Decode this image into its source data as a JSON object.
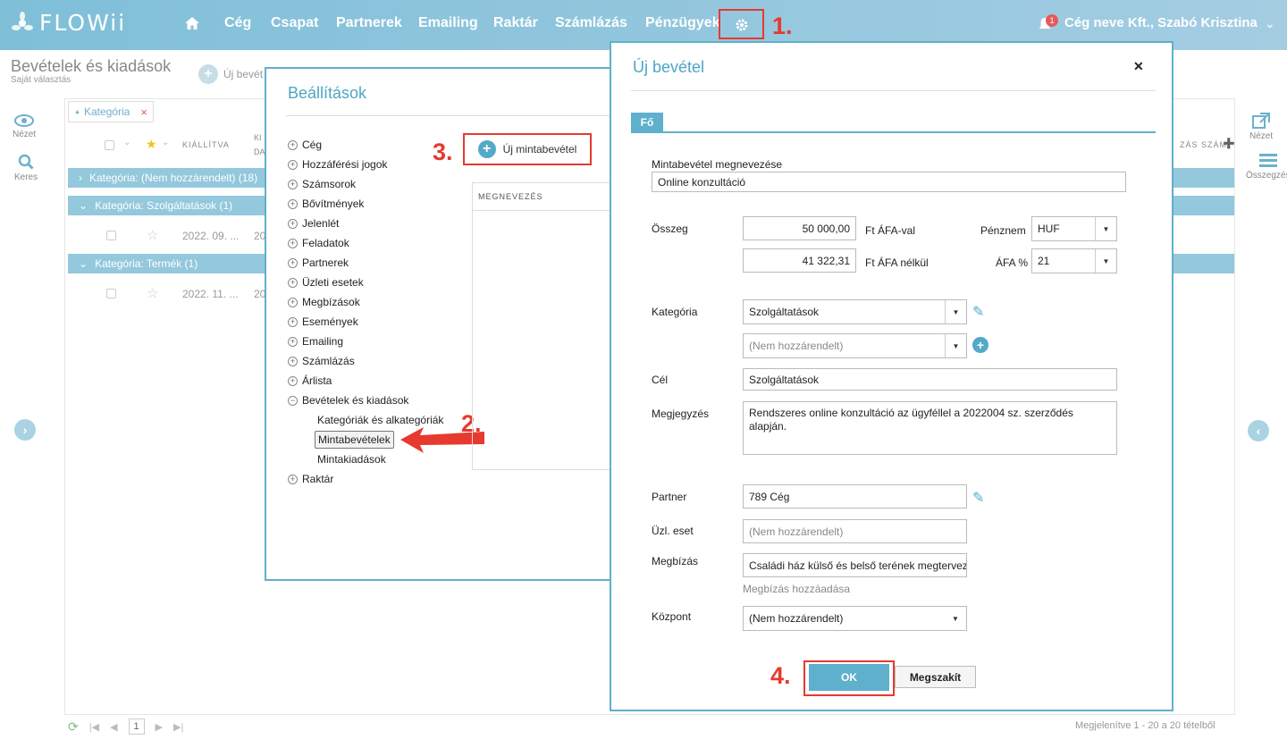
{
  "topbar": {
    "logo": "FLOWii",
    "nav": [
      "Cég",
      "Csapat",
      "Partnerek",
      "Emailing",
      "Raktár",
      "Számlázás",
      "Pénzügyek"
    ],
    "notif_count": "1",
    "user": "Cég neve Kft., Szabó Krisztina"
  },
  "steps": {
    "s1": "1.",
    "s2": "2.",
    "s3": "3.",
    "s4": "4."
  },
  "page": {
    "title": "Bevételek és kiadások",
    "subtitle": "Saját választás",
    "new_btn": "Új bevét",
    "filter_tag": "Kategória",
    "col_kiallitva": "KIÁLLÍTVA",
    "col_ki": "KI",
    "col_da": "DA",
    "col_szamla": "ZÁS SZÁM",
    "groups": [
      "Kategória: (Nem hozzárendelt) (18)",
      "Kategória: Szolgáltatások (1)",
      "Kategória: Termék (1)"
    ],
    "rows": [
      {
        "date": "2022. 09. ...",
        "col2": "20"
      },
      {
        "date": "2022. 11. ...",
        "col2": "20"
      }
    ],
    "side_left": [
      "Nézet",
      "Keres"
    ],
    "side_right": [
      "Nézet",
      "Összegzés"
    ],
    "page_num": "1",
    "footer": "Megjelenítve 1 - 20 a 20 tételből"
  },
  "settings": {
    "title": "Beállítások",
    "new_button": "Új mintabevétel",
    "panel_header": "MEGNEVEZÉS",
    "tree": [
      "Cég",
      "Hozzáférési jogok",
      "Számsorok",
      "Bővítmények",
      "Jelenlét",
      "Feladatok",
      "Partnerek",
      "Üzleti esetek",
      "Megbízások",
      "Események",
      "Emailing",
      "Számlázás",
      "Árlista",
      "Bevételek és kiadások"
    ],
    "subtree": [
      "Kategóriák és alkategóriák",
      "Mintabevételek",
      "Mintakiadások"
    ],
    "tree_last": "Raktár"
  },
  "newinc": {
    "title": "Új bevétel",
    "tab": "Fő",
    "name_label": "Mintabevétel megnevezése",
    "name_value": "Online konzultáció",
    "amount_label": "Összeg",
    "amount_gross": "50 000,00",
    "gross_unit": "Ft ÁFA-val",
    "amount_net": "41 322,31",
    "net_unit": "Ft ÁFA nélkül",
    "currency_label": "Pénznem",
    "currency": "HUF",
    "vat_label": "ÁFA %",
    "vat": "21",
    "category_label": "Kategória",
    "category": "Szolgáltatások",
    "subcategory": "(Nem hozzárendelt)",
    "goal_label": "Cél",
    "goal": "Szolgáltatások",
    "note_label": "Megjegyzés",
    "note": "Rendszeres online konzultáció az ügyféllel a 2022004 sz. szerződés alapján.",
    "partner_label": "Partner",
    "partner": "789 Cég",
    "case_label": "Üzl. eset",
    "case_placeholder": "(Nem hozzárendelt)",
    "assignment_label": "Megbízás",
    "assignment": "Családi ház külső és belső terének megtervezése",
    "assignment_link": "Megbízás hozzáadása",
    "center_label": "Központ",
    "center": "(Nem hozzárendelt)",
    "ok": "OK",
    "cancel": "Megszakít"
  }
}
